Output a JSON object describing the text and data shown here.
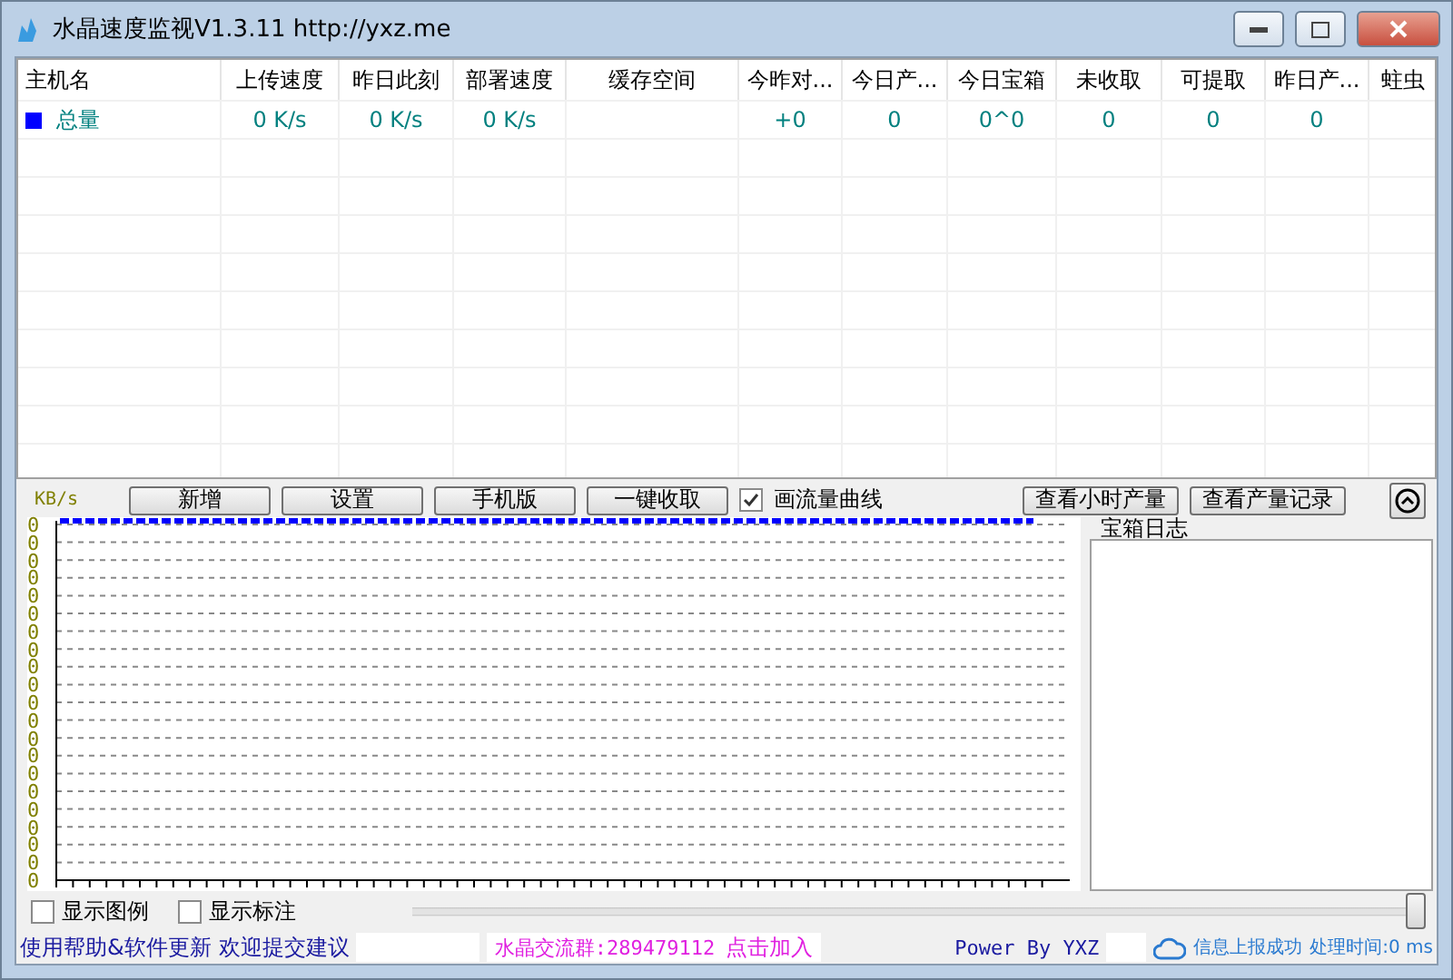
{
  "window": {
    "title": "水晶速度监视V1.3.11 http://yxz.me"
  },
  "table": {
    "columns": [
      "主机名",
      "上传速度",
      "昨日此刻",
      "部署速度",
      "缓存空间",
      "今昨对...",
      "今日产...",
      "今日宝箱",
      "未收取",
      "可提取",
      "昨日产...",
      "蛀虫"
    ],
    "rows": [
      {
        "color": "#0000ff",
        "cells": [
          "总量",
          "0 K/s",
          "0 K/s",
          "0 K/s",
          "",
          "+0",
          "0",
          "0^0",
          "0",
          "0",
          "0",
          ""
        ]
      }
    ]
  },
  "toolbar": {
    "unit": "KB/s",
    "buttons": [
      "新增",
      "设置",
      "手机版",
      "一键收取"
    ],
    "draw_curve": {
      "label": "画流量曲线",
      "checked": true
    },
    "right_buttons": [
      "查看小时产量",
      "查看产量记录"
    ]
  },
  "chart": {
    "y_labels": [
      "0",
      "0",
      "0",
      "0",
      "0",
      "0",
      "0",
      "0",
      "0",
      "0",
      "0",
      "0",
      "0",
      "0",
      "0",
      "0",
      "0",
      "0",
      "0",
      "0",
      "0"
    ]
  },
  "log_panel": {
    "title": "宝箱日志"
  },
  "options": [
    {
      "label": "显示图例",
      "checked": false
    },
    {
      "label": "显示标注",
      "checked": false
    }
  ],
  "slider": {
    "level": 1
  },
  "status_bar": {
    "help_link": "使用帮助&软件更新",
    "suggest_link": "欢迎提交建议",
    "group": "水晶交流群:289479112",
    "join": "点击加入",
    "power": "Power By YXZ",
    "report": "信息上报成功",
    "time": "处理时间:0 ms"
  }
}
